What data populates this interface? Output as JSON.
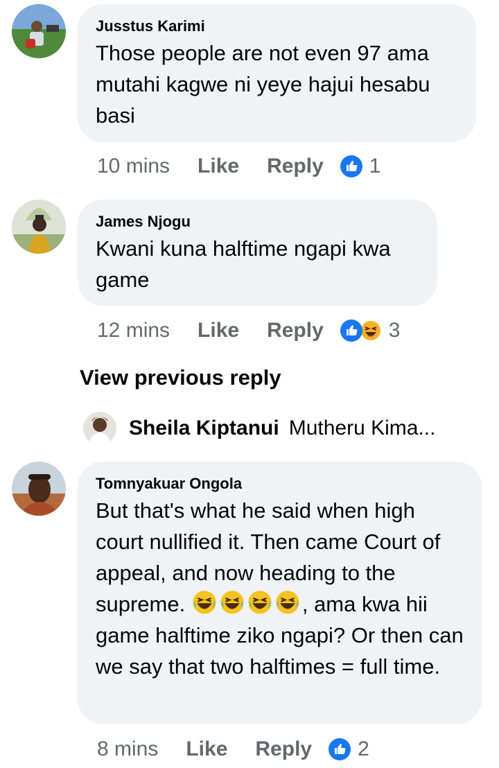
{
  "comments": [
    {
      "author": "Jusstus Karimi",
      "text": "Those people are not even 97 ama mutahi kagwe ni yeye hajui hesabu basi",
      "time": "10 mins",
      "like_label": "Like",
      "reply_label": "Reply",
      "reaction_count": "1",
      "reactions": [
        "like-icon"
      ]
    },
    {
      "author": "James Njogu",
      "text": "Kwani kuna halftime ngapi kwa game",
      "time": "12 mins",
      "like_label": "Like",
      "reply_label": "Reply",
      "reaction_count": "3",
      "reactions": [
        "like-icon",
        "haha-icon"
      ]
    },
    {
      "author": "Tomnyakuar Ongola",
      "text_before_emoji": "But that's what he said when high court nullified it. Then came Court of appeal, and now heading to the supreme. ",
      "text_after_emoji": ", ama kwa hii game halftime ziko ngapi? Or then can we say that two halftimes = full time.",
      "emoji": [
        "rolling-laughing-emoji",
        "rolling-laughing-emoji",
        "rolling-laughing-emoji",
        "rolling-laughing-emoji"
      ],
      "time": "8 mins",
      "like_label": "Like",
      "reply_label": "Reply",
      "reaction_count": "2",
      "reactions": [
        "like-icon"
      ]
    }
  ],
  "view_previous_reply": "View previous reply",
  "reply_preview": {
    "author": "Sheila Kiptanui",
    "snippet": "Mutheru Kima..."
  },
  "colors": {
    "bubble": "#f0f2f5",
    "meta_text": "#65676b",
    "like_blue": "#1877f2",
    "haha_yellow": "#f7b125"
  }
}
